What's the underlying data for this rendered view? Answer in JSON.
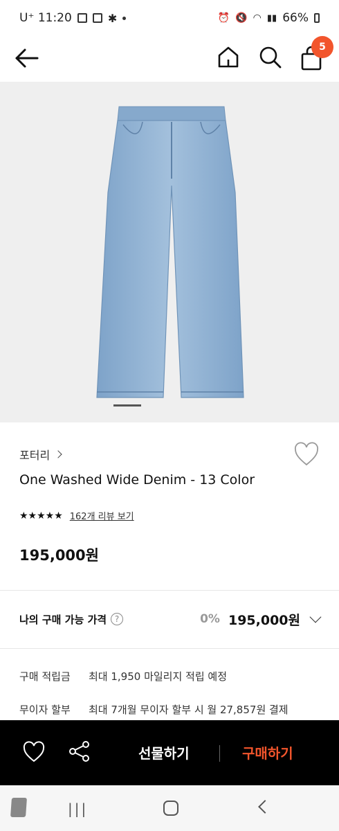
{
  "status_bar": {
    "carrier_time": "U⁺ 11:20",
    "battery": "66%"
  },
  "header": {
    "cart_count": "5"
  },
  "product": {
    "brand": "포터리",
    "name": "One Washed Wide Denim - 13 Color",
    "stars": "★★★★★",
    "review_link": "162개 리뷰 보기",
    "price": "195,000원"
  },
  "my_price": {
    "label": "나의 구매 가능 가격",
    "help": "?",
    "discount": "0%",
    "value": "195,000원"
  },
  "info": {
    "points_label": "구매 적립금",
    "points_value": "최대 1,950 마일리지 적립 예정",
    "installment_label": "무이자 할부",
    "installment_value": "최대 7개월 무이자 할부 시 월 27,857원 결제"
  },
  "bottom_bar": {
    "gift_label": "선물하기",
    "buy_label": "구매하기"
  },
  "nav_bar": {
    "recent": "|||"
  },
  "colors": {
    "accent": "#f2552c",
    "denim": "#8fb1d4",
    "hero_bg": "#efefef"
  }
}
